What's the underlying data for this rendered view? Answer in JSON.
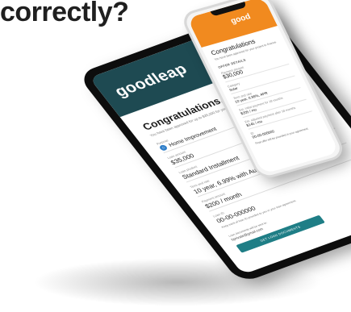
{
  "headline": "correctly?",
  "tablet": {
    "logo": "goodleap",
    "title": "Congratulations, Julia!",
    "subtitle": "You have been approved for up to $35,000 for your home project.",
    "fields": [
      {
        "label": "Purpose",
        "value": "Home Improvement"
      },
      {
        "label": "Loan amount",
        "value": "$35,000"
      },
      {
        "label": "Loan product",
        "value": "Standard Installment"
      },
      {
        "label": "Term and rate",
        "value": "10 year, 6.99% with Autopay"
      },
      {
        "label": "Payment amount",
        "value": "$200 / month"
      },
      {
        "label": "Loan ID",
        "value": "00-00-000000"
      }
    ],
    "note": "Keep track of loan ID provided to you in your loan agreement.",
    "email_label": "Loan documents will be sent to:",
    "email_value": "bprivate@gmail.com",
    "cta_label": "GET LOAN DOCUMENTS"
  },
  "phone": {
    "logo": "good",
    "title": "Congratulations",
    "subtitle": "You have been approved for your project to finance.",
    "section": "OFFER DETAILS",
    "fields": [
      {
        "label": "Payment amount",
        "value": "$30,000"
      },
      {
        "label": "Category",
        "value": "Solar"
      },
      {
        "label": "Term and rate",
        "value": "10 year, 0.99%, APR"
      },
      {
        "label": "Est. initial payment for 18 months",
        "value": "$205 / mo"
      },
      {
        "label": "Est. adjusted payment after 18 months",
        "value": "$145 / mo"
      },
      {
        "label": "ID",
        "value": "00-00-000000"
      }
    ],
    "note": "Final offer will be provided in your agreement."
  }
}
